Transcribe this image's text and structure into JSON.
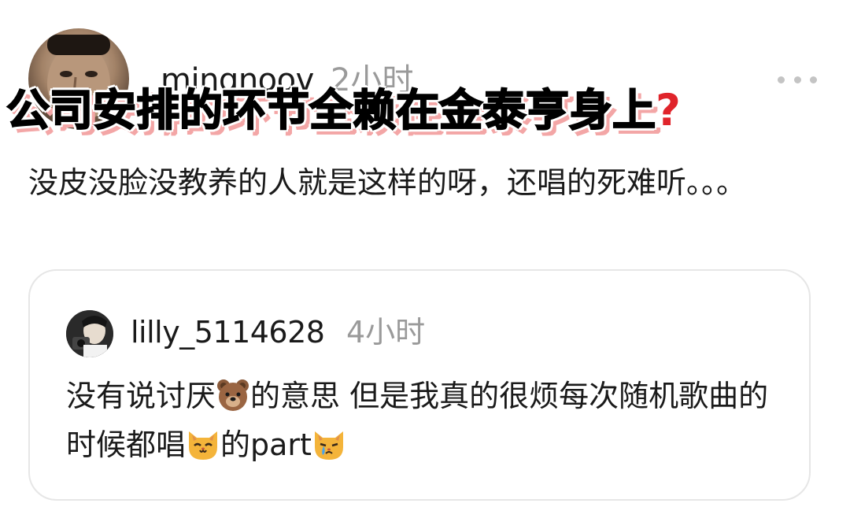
{
  "post": {
    "username": "mingnoov",
    "time": "2小时",
    "text": "没皮没脸没教养的人就是这样的呀，还唱的死难听。。。"
  },
  "overlay": {
    "headline": "公司安排的环节全赖在金泰亨身上",
    "headline_icon": "red-question-mark",
    "stroke_color": "#ffffff",
    "shadow_color": "#f3a6a6",
    "icon_color": "#e0242b"
  },
  "reply": {
    "username": "lilly_5114628",
    "time": "4小时",
    "text_part1": "没有说讨厌",
    "emoji1": "bear-face",
    "text_part2": "的意思 但是我真的很烦每次随机歌曲的时候都唱",
    "emoji2": "cat-face",
    "text_part3": "的part",
    "emoji3": "crying-cat-face"
  },
  "colors": {
    "text": "#1a1a1a",
    "secondary": "#9a9a9a",
    "card_border": "#e6e6e6",
    "more_dots": "#c4c4c4"
  }
}
